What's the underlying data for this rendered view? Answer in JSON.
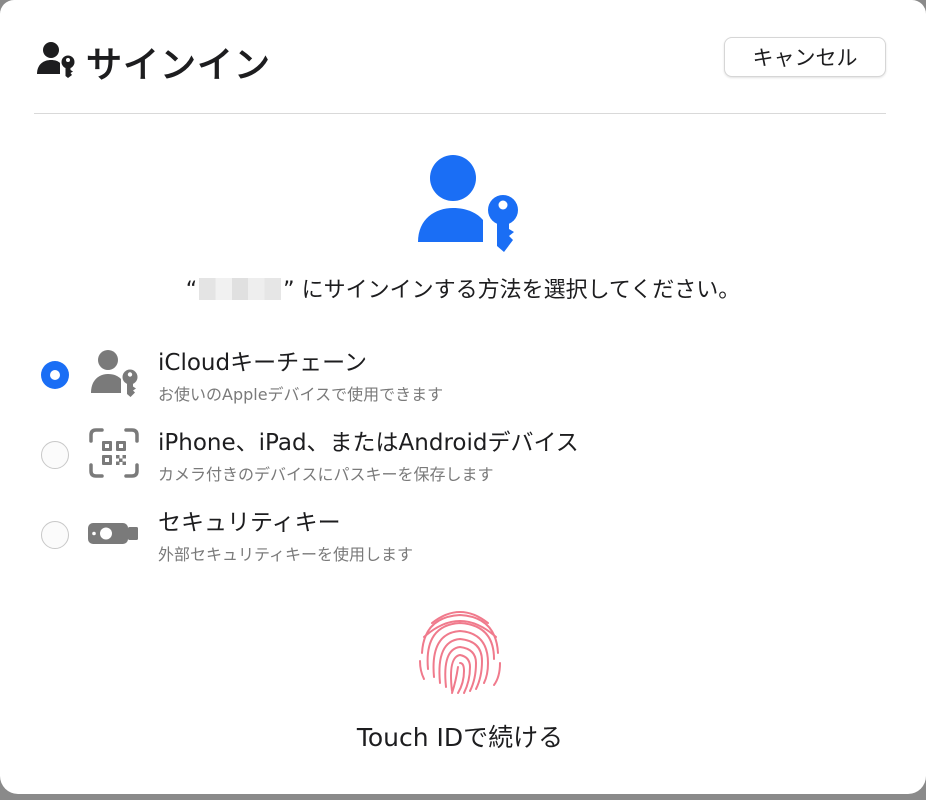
{
  "dialog": {
    "title": "サインイン",
    "cancel_label": "キャンセル",
    "prompt_open_quote": "“",
    "prompt_close_quote": "”",
    "prompt_text": "にサインインする方法を選択してください。"
  },
  "options": [
    {
      "title": "iCloudキーチェーン",
      "subtitle": "お使いのAppleデバイスで使用できます",
      "icon": "person-key-icon",
      "selected": true
    },
    {
      "title": "iPhone、iPad、またはAndroidデバイス",
      "subtitle": "カメラ付きのデバイスにパスキーを保存します",
      "icon": "qr-code-icon",
      "selected": false
    },
    {
      "title": "セキュリティキー",
      "subtitle": "外部セキュリティキーを使用します",
      "icon": "security-key-icon",
      "selected": false
    }
  ],
  "touch_id": {
    "label": "Touch IDで続ける",
    "icon": "fingerprint-icon"
  },
  "colors": {
    "accent": "#1a6ef5",
    "icon_gray": "#7a7a7a",
    "fingerprint": "#f07a8c"
  }
}
